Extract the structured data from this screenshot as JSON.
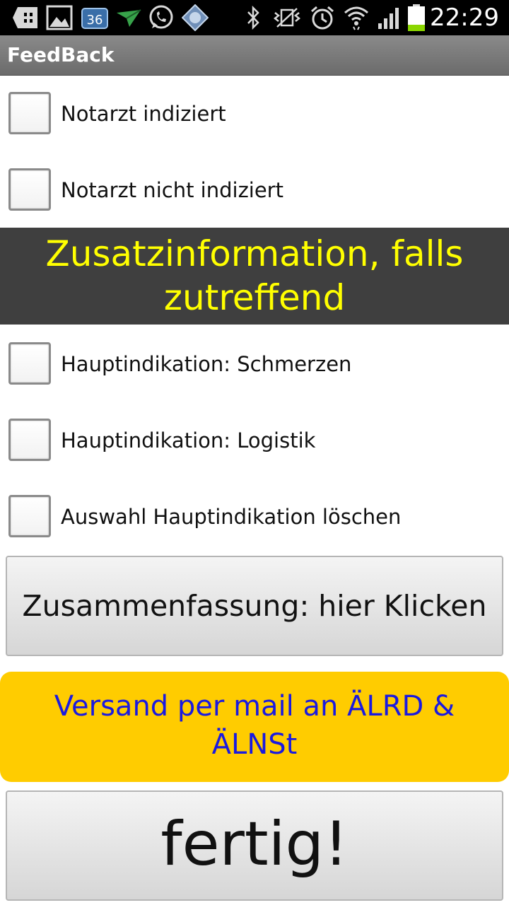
{
  "status_bar": {
    "time": "22:29",
    "notification_badge": "36",
    "icons": [
      "add-icon",
      "gallery-icon",
      "calendar-icon",
      "send-icon",
      "whatsapp-icon",
      "app-icon",
      "bluetooth-icon",
      "vibrate-icon",
      "alarm-icon",
      "wifi-icon",
      "signal-icon",
      "battery-icon"
    ],
    "battery_level": 0.25,
    "battery_color": "#8bd600"
  },
  "title_bar": {
    "title": "FeedBack"
  },
  "checkboxes_top": [
    {
      "label": "Notarzt indiziert",
      "checked": false
    },
    {
      "label": "Notarzt nicht indiziert",
      "checked": false
    }
  ],
  "section_header": {
    "text_line1": "Zusatzinformation, falls",
    "text_line2": "zutreffend",
    "text_color": "#ffff00",
    "background": "#3f3f3f"
  },
  "checkboxes_bottom": [
    {
      "label": "Hauptindikation: Schmerzen",
      "checked": false
    },
    {
      "label": "Hauptindikation: Logistik",
      "checked": false
    },
    {
      "label": "Auswahl Hauptindikation löschen",
      "checked": false
    }
  ],
  "buttons": {
    "summary_label": "Zusammenfassung: hier Klicken",
    "mail_label_line1": "Versand per mail an ÄLRD &",
    "mail_label_line2": "ÄLNSt",
    "mail_background": "#ffcc00",
    "mail_text_color": "#1a1ae0",
    "done_label": "fertig!"
  }
}
